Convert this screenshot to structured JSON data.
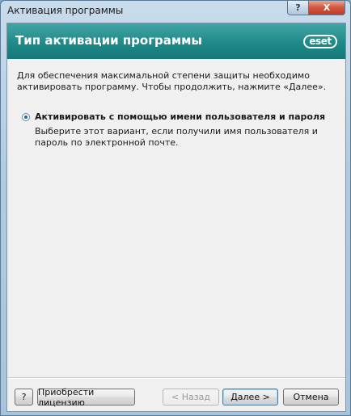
{
  "window": {
    "title": "Активация программы",
    "help_glyph": "?",
    "close_glyph": "X"
  },
  "header": {
    "title": "Тип активации программы",
    "logo_text": "eset"
  },
  "content": {
    "intro": "Для обеспечения максимальной степени защиты необходимо активировать программу. Чтобы продолжить, нажмите «Далее».",
    "option": {
      "label": "Активировать с помощью имени пользователя и пароля",
      "description": "Выберите этот вариант, если получили имя пользователя и пароль по электронной почте.",
      "selected": true
    }
  },
  "buttons": {
    "help": "?",
    "buy": "Приобрести лицензию",
    "back": "< Назад",
    "next": "Далее >",
    "cancel": "Отмена"
  },
  "colors": {
    "header_teal": "#1f8a89",
    "title_bar": "#b3cbe0",
    "close_red": "#c23a22"
  }
}
